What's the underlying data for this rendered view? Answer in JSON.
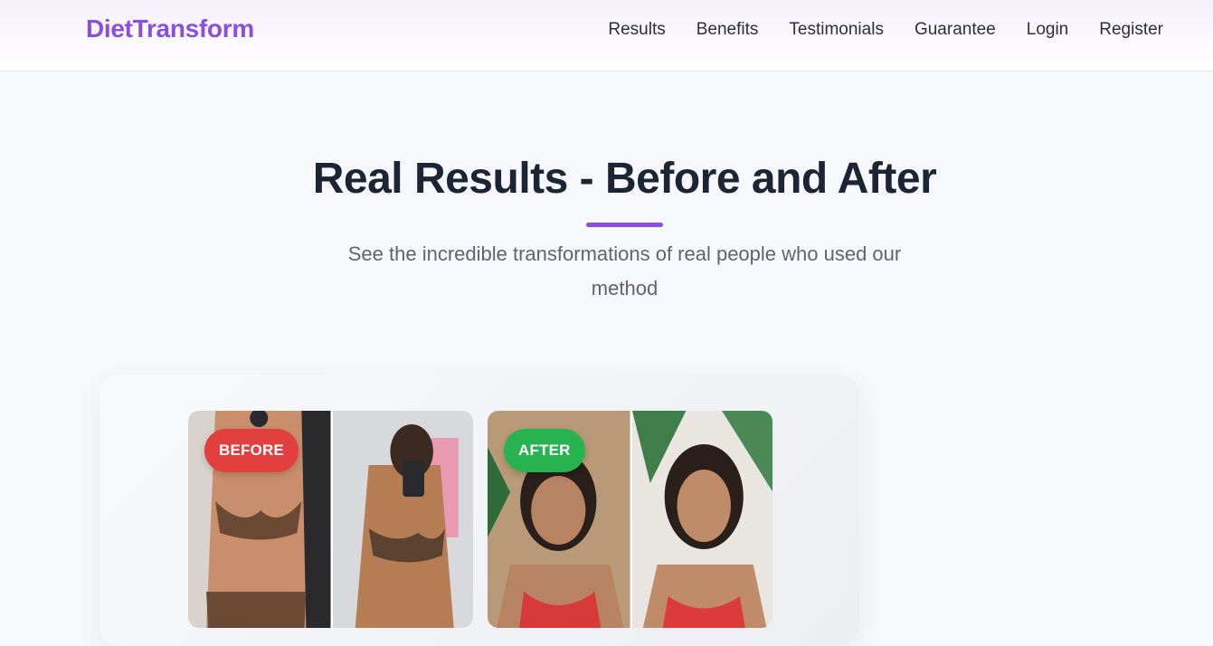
{
  "header": {
    "logo": "DietTransform",
    "nav": [
      "Results",
      "Benefits",
      "Testimonials",
      "Guarantee",
      "Login",
      "Register"
    ]
  },
  "hero": {
    "title": "Real Results - Before and After",
    "subtitle": "See the incredible transformations of real people who used our method"
  },
  "gallery": {
    "before_label": "BEFORE",
    "after_label": "AFTER"
  },
  "colors": {
    "brand": "#8a4fe0",
    "before_badge": "#e2403f",
    "after_badge": "#28b350",
    "heading": "#1c2533"
  }
}
